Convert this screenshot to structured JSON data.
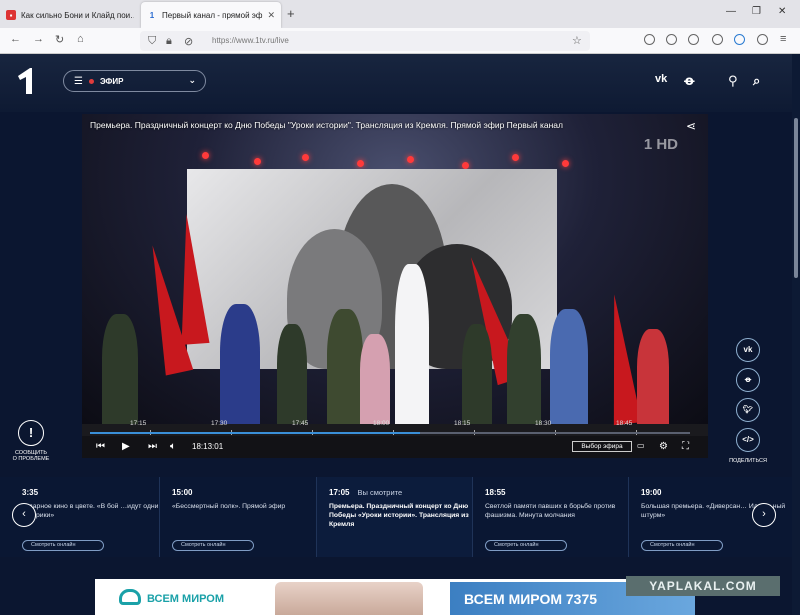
{
  "browser": {
    "tabs": [
      {
        "title": "Как сильно Бони и Клайд пои…",
        "active": false
      },
      {
        "title": "Первый канал - прямой эфир",
        "active": true
      }
    ],
    "url": "https://www.1tv.ru/live"
  },
  "site": {
    "menu_label": "ЭФИР"
  },
  "player": {
    "title": "Премьера. Праздничный концерт ко Дню Победы \"Уроки истории\". Трансляция из Кремля. Прямой эфир Первый канал",
    "watermark": "HD",
    "timeline_ticks": [
      "17:15",
      "17:30",
      "17:45",
      "18:00",
      "18:15",
      "18:30",
      "18:45"
    ],
    "progress": 0.55,
    "current_time": "18:13:01",
    "select_button": "Выбор эфира"
  },
  "sidebar": {
    "report_label_line1": "СООБЩИТЬ",
    "report_label_line2": "О ПРОБЛЕМЕ",
    "share_label": "ПОДЕЛИТЬСЯ",
    "share_icons": [
      "vk",
      "ok",
      "twitter",
      "embed"
    ]
  },
  "schedule": {
    "slots": [
      {
        "time": "3:35",
        "now_label": "",
        "program": "…дарное кино в цвете. «В бой …идут одни «старики»",
        "watch": "Смотреть онлайн",
        "current": false
      },
      {
        "time": "15:00",
        "now_label": "",
        "program": "«Бессмертный полк». Прямой эфир",
        "watch": "Смотреть онлайн",
        "current": false
      },
      {
        "time": "17:05",
        "now_label": "Вы смотрите",
        "program": "Премьера. Праздничный концерт ко Дню Победы «Уроки истории». Трансляция из Кремля",
        "watch": "",
        "current": true
      },
      {
        "time": "18:55",
        "now_label": "",
        "program": "Светлой памяти павших в борьбе против фашизма. Минута молчания",
        "watch": "Смотреть онлайн",
        "current": false
      },
      {
        "time": "19:00",
        "now_label": "",
        "program": "Большая премьера. «Диверсан… Идеальный штурм»",
        "watch": "Смотреть онлайн",
        "current": false
      }
    ]
  },
  "ad": {
    "brand": "ВСЕМ МИРОМ",
    "banner_text": "ВСЕМ МИРОМ 7375"
  },
  "watermark_site": "YAPLAKAL.COM",
  "colors": {
    "accent": "#3a8fd8",
    "header_bg": "#0e1a33",
    "flag_red": "#c8181e",
    "ad_teal": "#1aa1a8"
  }
}
